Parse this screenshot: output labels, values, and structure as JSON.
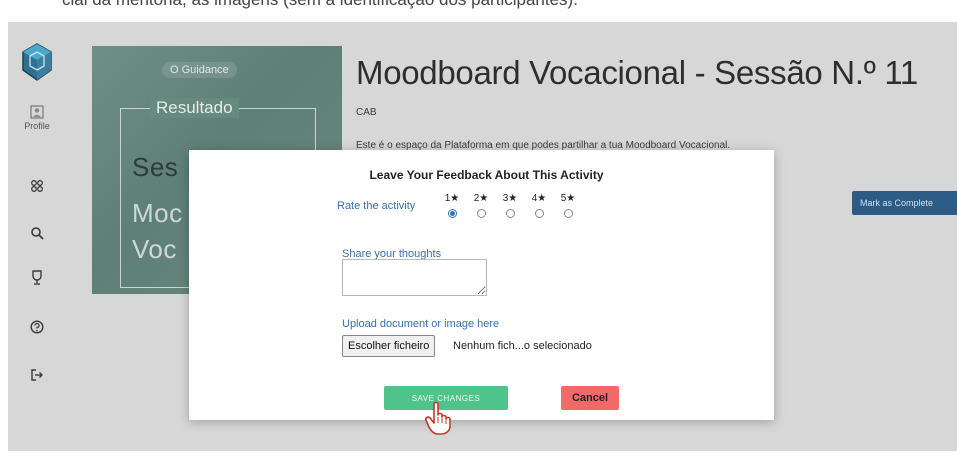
{
  "top_caption": "cial da mentoria, as imagens (sem a identificação dos participantes).",
  "sidebar": {
    "profile_label": "Profile",
    "icons": [
      "grid-icon",
      "search-icon",
      "trophy-icon",
      "help-icon",
      "logout-icon"
    ]
  },
  "hero": {
    "brand": "O Guidance",
    "subtitle": "Resultado",
    "line1": "Ses",
    "line2": "Moc",
    "line3": "Voc"
  },
  "page": {
    "title": "Moodboard Vocacional - Sessão N.º 11",
    "subtitle": "CAB",
    "description": "Este é o espaço da Plataforma em que podes partilhar a tua Moodboard Vocacional.",
    "complete_button": "Mark as Complete"
  },
  "modal": {
    "title": "Leave Your Feedback About This Activity",
    "rate_label": "Rate the activity",
    "rating_options": [
      "1★",
      "2★",
      "3★",
      "4★",
      "5★"
    ],
    "selected_rating": "1★",
    "thoughts_label": "Share your thoughts",
    "thoughts_value": "",
    "upload_label": "Upload document or image here",
    "file_button": "Escolher ficheiro",
    "file_status": "Nenhum fich...o selecionado",
    "save_button": "SAVE CHANGES",
    "cancel_button": "Cancel"
  },
  "colors": {
    "overlay": "#d7d7d7",
    "link_blue": "#3a6fa8",
    "save_green": "#4fc48a",
    "cancel_red": "#f06a6a",
    "complete_blue": "#2c5c86"
  }
}
